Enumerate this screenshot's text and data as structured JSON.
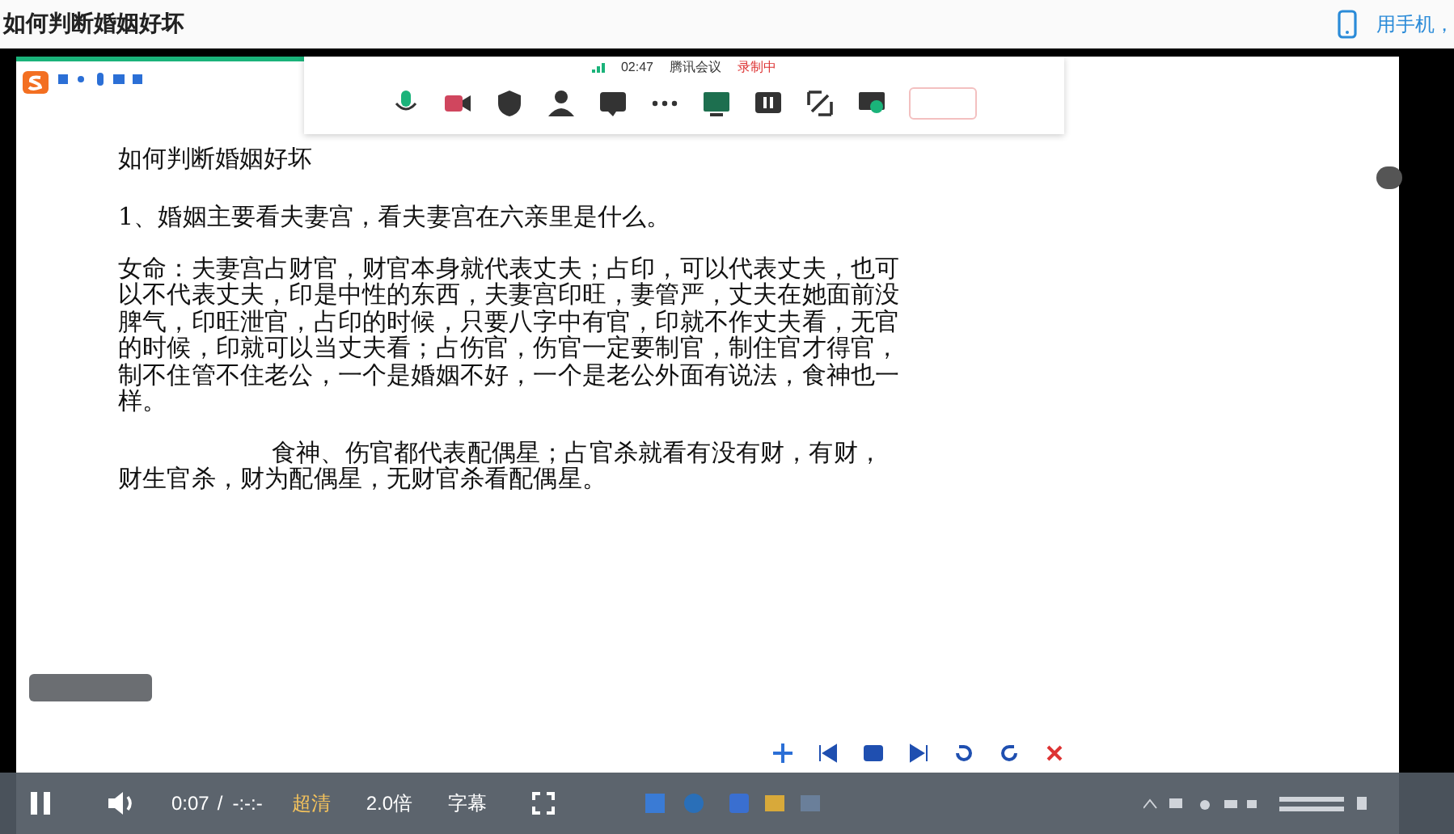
{
  "page": {
    "title": "如何判断婚姻好坏",
    "phone_link": "用手机，"
  },
  "meeting": {
    "time": "02:47",
    "app_name": "腾讯会议",
    "recording": "录制中"
  },
  "document": {
    "heading": "如何判断婚姻好坏",
    "paragraphs": [
      {
        "kind": "plain",
        "text": "1、婚姻主要看夫妻宫，看夫妻宫在六亲里是什么。"
      },
      {
        "kind": "plain",
        "text": "女命：夫妻宫占财官，财官本身就代表丈夫；占印，可以代表丈夫，也可以不代表丈夫，印是中性的东西，夫妻宫印旺，妻管严，丈夫在她面前没脾气，印旺泄官，占印的时候，只要八字中有官，印就不作丈夫看，无官的时候，印就可以当丈夫看；占伤官，伤官一定要制官，制住官才得官，制不住管不住老公，一个是婚姻不好，一个是老公外面有说法，食神也一样。"
      },
      {
        "kind": "indented",
        "text": "食神、伤官都代表配偶星；占官杀就看有没有财，有财，财生官杀，财为配偶星，无财官杀看配偶星。"
      }
    ]
  },
  "player": {
    "playing": true,
    "current_time": "0:07",
    "separator": "/",
    "duration": "-:-:-",
    "quality": "超清",
    "speed": "2.0倍",
    "subtitles": "字幕"
  }
}
